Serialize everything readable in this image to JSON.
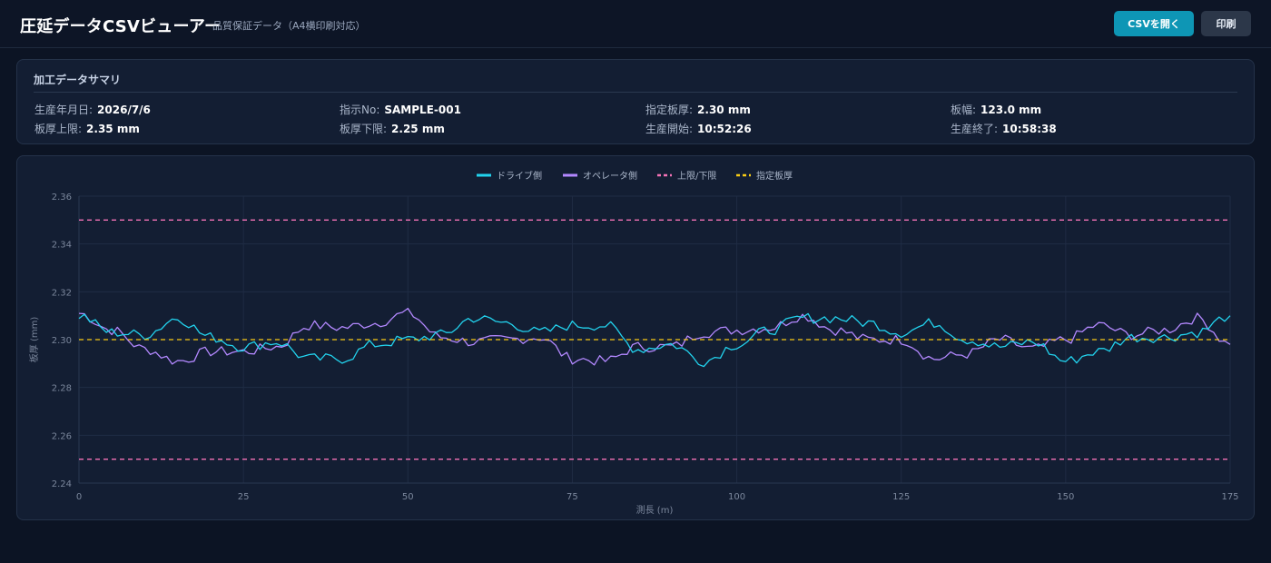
{
  "header": {
    "title": "圧延データCSVビューアー",
    "subtitle": "品質保証データ（A4横印刷対応）",
    "open_csv_label": "CSVを開く",
    "print_label": "印刷"
  },
  "summary": {
    "title": "加工データサマリ",
    "fields": [
      {
        "label": "生産年月日:",
        "value": "2026/7/6"
      },
      {
        "label": "指示No:",
        "value": "SAMPLE-001"
      },
      {
        "label": "指定板厚:",
        "value": "2.30 mm"
      },
      {
        "label": "板幅:",
        "value": "123.0 mm"
      },
      {
        "label": "板厚上限:",
        "value": "2.35 mm"
      },
      {
        "label": "板厚下限:",
        "value": "2.25 mm"
      },
      {
        "label": "生産開始:",
        "value": "10:52:26"
      },
      {
        "label": "生産終了:",
        "value": "10:58:38"
      }
    ]
  },
  "colors": {
    "drive": "#22d3ee",
    "operator": "#b388ff",
    "limits": "#f472b6",
    "target": "#facc15",
    "grid": "#1f2c44",
    "tick": "#7b879c"
  },
  "chart_data": {
    "type": "line",
    "xlabel": "測長 (m)",
    "ylabel": "板厚 (mm)",
    "xlim": [
      0,
      175
    ],
    "ylim": [
      2.24,
      2.36
    ],
    "x_ticks": [
      "0",
      "25",
      "50",
      "75",
      "100",
      "125",
      "150",
      "175"
    ],
    "y_ticks": [
      "2.24",
      "2.26",
      "2.28",
      "2.30",
      "2.32",
      "2.34",
      "2.36"
    ],
    "legend_position": "top-center",
    "grid": true,
    "series": [
      {
        "name": "ドライブ側",
        "x": [
          0,
          5,
          10,
          15,
          20,
          25,
          30,
          35,
          40,
          45,
          50,
          55,
          60,
          65,
          70,
          75,
          80,
          85,
          90,
          95,
          100,
          105,
          110,
          115,
          120,
          125,
          130,
          135,
          140,
          145,
          150,
          155,
          160,
          165,
          170,
          175
        ],
        "values": [
          2.31,
          2.303,
          2.302,
          2.309,
          2.301,
          2.297,
          2.299,
          2.292,
          2.292,
          2.298,
          2.3,
          2.302,
          2.309,
          2.307,
          2.303,
          2.306,
          2.306,
          2.296,
          2.298,
          2.291,
          2.298,
          2.304,
          2.309,
          2.309,
          2.307,
          2.303,
          2.307,
          2.3,
          2.297,
          2.299,
          2.291,
          2.295,
          2.301,
          2.301,
          2.303,
          2.31
        ]
      },
      {
        "name": "オペレータ側",
        "x": [
          0,
          5,
          10,
          15,
          20,
          25,
          30,
          35,
          40,
          45,
          50,
          55,
          60,
          65,
          70,
          75,
          80,
          85,
          90,
          95,
          100,
          105,
          110,
          115,
          120,
          125,
          130,
          135,
          140,
          145,
          150,
          155,
          160,
          165,
          170,
          175
        ],
        "values": [
          2.311,
          2.304,
          2.296,
          2.291,
          2.295,
          2.295,
          2.297,
          2.306,
          2.305,
          2.307,
          2.311,
          2.301,
          2.299,
          2.3,
          2.301,
          2.292,
          2.291,
          2.297,
          2.297,
          2.303,
          2.304,
          2.305,
          2.31,
          2.304,
          2.3,
          2.3,
          2.292,
          2.294,
          2.3,
          2.296,
          2.3,
          2.306,
          2.302,
          2.304,
          2.309,
          2.298
        ]
      },
      {
        "name": "上限/下限",
        "dashed": true,
        "upper": 2.35,
        "lower": 2.25
      },
      {
        "name": "指定板厚",
        "dashed": true,
        "value": 2.3
      }
    ]
  }
}
